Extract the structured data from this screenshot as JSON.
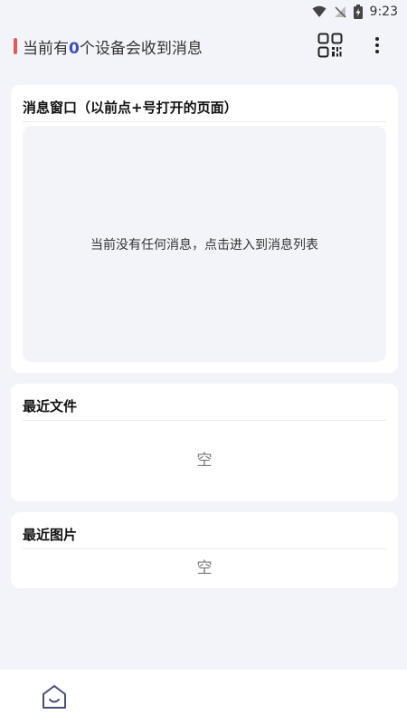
{
  "status_bar": {
    "time": "9:23",
    "icons": [
      "wifi-icon",
      "no-signal-icon",
      "battery-charging-icon"
    ]
  },
  "header": {
    "title_prefix": "当前有",
    "device_count": "0",
    "title_suffix": "个设备会收到消息",
    "accent_color": "#e05a5a",
    "count_color": "#3f51b5",
    "icons": [
      "qr-code-icon",
      "more-vert-icon"
    ]
  },
  "message_window": {
    "title": "消息窗口（以前点+号打开的页面）",
    "empty_text": "当前没有任何消息，点击进入到消息列表"
  },
  "recent_files": {
    "title": "最近文件",
    "empty_text": "空"
  },
  "recent_images": {
    "title": "最近图片",
    "empty_text": "空"
  },
  "bottom_nav": {
    "icons": [
      "home-icon"
    ],
    "icon_color": "#4a4f7a"
  }
}
